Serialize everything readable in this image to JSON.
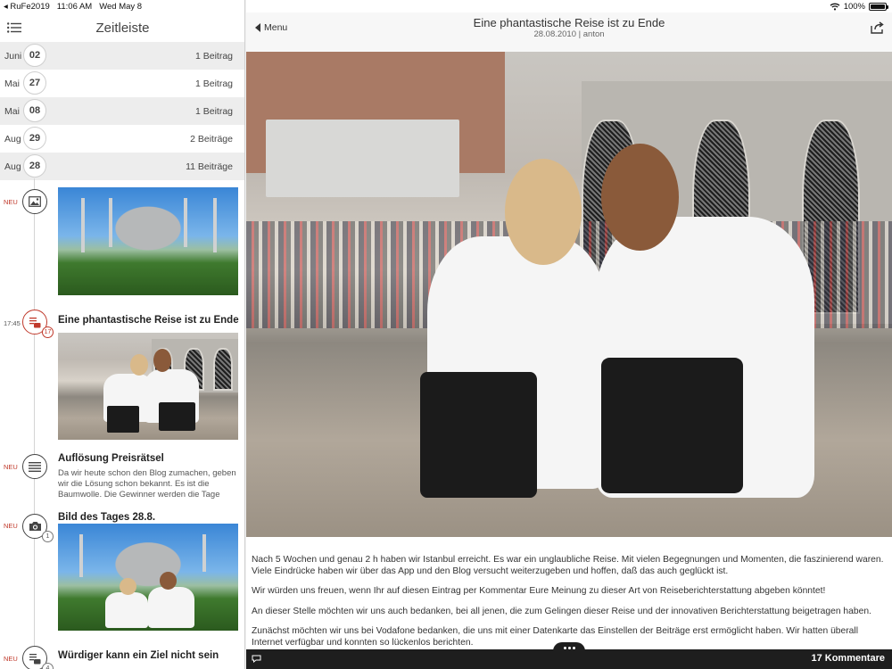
{
  "status": {
    "carrier": "◂ RuFe2019",
    "time": "11:06 AM",
    "date": "Wed May 8",
    "battery": "100%"
  },
  "sidebar": {
    "title": "Zeitleiste",
    "dates": [
      {
        "month": "Juni",
        "day": "02",
        "count": "1 Beitrag"
      },
      {
        "month": "Mai",
        "day": "27",
        "count": "1 Beitrag"
      },
      {
        "month": "Mai",
        "day": "08",
        "count": "1 Beitrag"
      },
      {
        "month": "Aug",
        "day": "29",
        "count": "2 Beiträge"
      },
      {
        "month": "Aug",
        "day": "28",
        "count": "11 Beiträge"
      }
    ],
    "entries": [
      {
        "tag": "NEU",
        "icon": "image-icon"
      },
      {
        "time": "17:45",
        "title": "Eine phantastische Reise ist zu Ende",
        "badge": "17",
        "icon": "blog-post-icon"
      },
      {
        "tag": "NEU",
        "title": "Auflösung Preisrätsel",
        "text": "Da wir heute schon den Blog zumachen, geben wir die Lösung schon bekannt. Es ist die Baumwolle. Die Gewinner werden die Tage",
        "icon": "text-lines-icon"
      },
      {
        "tag": "NEU",
        "title": "Bild des Tages 28.8.",
        "badge": "1",
        "icon": "camera-icon"
      },
      {
        "tag": "NEU",
        "title": "Würdiger kann ein Ziel nicht sein",
        "badge": "4",
        "icon": "blog-post-icon"
      }
    ]
  },
  "main": {
    "back_label": "Menu",
    "title": "Eine phantastische Reise ist zu Ende",
    "subtitle": "28.08.2010 | anton",
    "paragraphs": [
      "Nach 5 Wochen und genau 2 h haben wir Istanbul erreicht. Es war ein unglaubliche Reise. Mit vielen Begegnungen und Momenten, die faszinierend waren. Viele Eindrücke haben wir über das App und den Blog versucht weiterzugeben und hoffen, daß das auch geglückt ist.",
      "Wir würden uns freuen, wenn Ihr auf diesen Eintrag per Kommentar Eure Meinung zu dieser Art von Reiseberichterstattung abgeben könntet!",
      "An dieser Stelle möchten wir uns auch bedanken, bei all jenen, die zum Gelingen dieser Reise und der innovativen Berichterstattung beigetragen haben.",
      "Zunächst möchten wir uns bei Vodafone bedanken, die uns mit einer Datenkarte das Einstellen der Beiträge erst ermöglicht haben. Wir hatten überall Internet verfügbar und konnten so lückenlos berichten."
    ],
    "comments_label": "17 Kommentare"
  },
  "colors": {
    "accent_red": "#c0392b",
    "bottom_bar": "#1e1e1e"
  }
}
